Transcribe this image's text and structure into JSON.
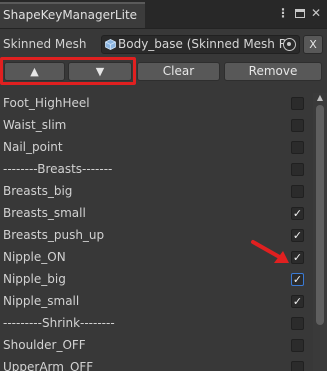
{
  "window": {
    "title": "ShapeKeyManagerLite"
  },
  "skinned_mesh": {
    "label": "Skinned Mesh",
    "value": "Body_base (Skinned Mesh Re",
    "clear_label": "X"
  },
  "toolbar": {
    "up_label": "▲",
    "down_label": "▼",
    "clear_label": "Clear",
    "remove_label": "Remove"
  },
  "shape_keys": [
    {
      "name": "Foot_HighHeel",
      "checked": false
    },
    {
      "name": "Waist_slim",
      "checked": false
    },
    {
      "name": "Nail_point",
      "checked": false
    },
    {
      "name": "--------Breasts-------",
      "checked": false
    },
    {
      "name": "Breasts_big",
      "checked": false
    },
    {
      "name": "Breasts_small",
      "checked": true
    },
    {
      "name": "Breasts_push_up",
      "checked": true
    },
    {
      "name": "Nipple_ON",
      "checked": true
    },
    {
      "name": "Nipple_big",
      "checked": true,
      "focused": true
    },
    {
      "name": "Nipple_small",
      "checked": true
    },
    {
      "name": "---------Shrink--------",
      "checked": false
    },
    {
      "name": "Shoulder_OFF",
      "checked": false
    },
    {
      "name": "UpperArm_OFF",
      "checked": false
    }
  ],
  "colors": {
    "highlight": "#e02020",
    "accent_focus": "#3a7ad4",
    "background": "#383838"
  }
}
